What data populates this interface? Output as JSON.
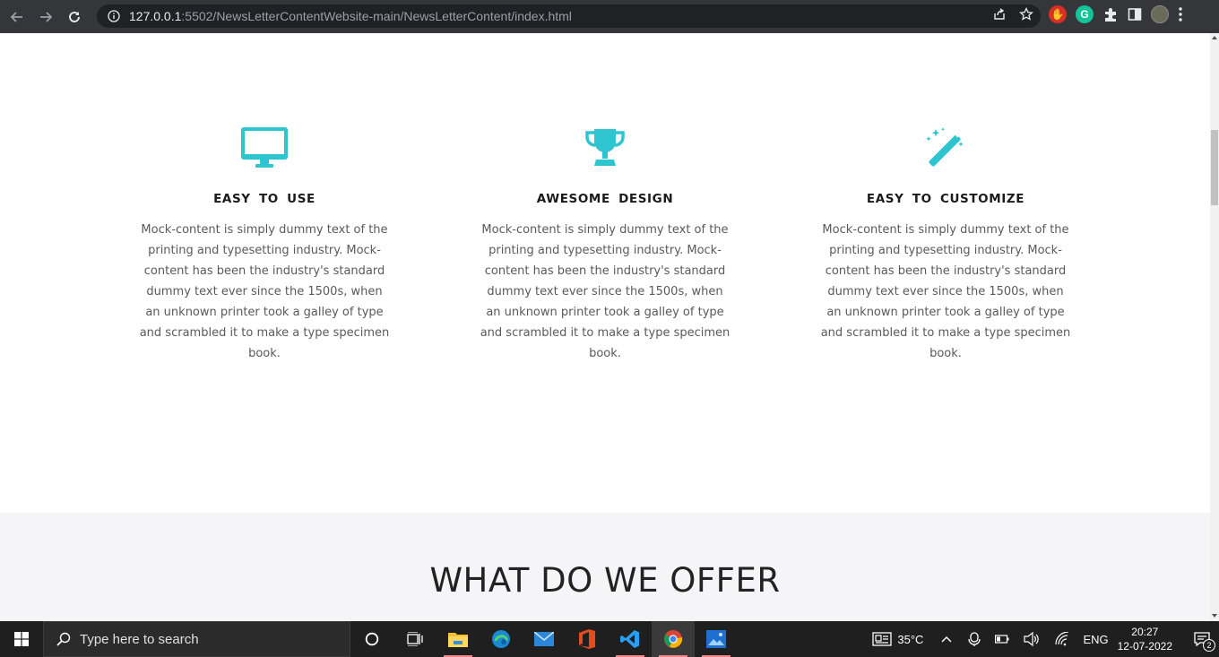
{
  "browser": {
    "url_host": "127.0.0.1",
    "url_path": ":5502/NewsLetterContentWebsite-main/NewsLetterContent/index.html"
  },
  "features": [
    {
      "icon": "monitor-icon",
      "title": "EASY TO USE",
      "text": "Mock-content is simply dummy text of the printing and typesetting industry. Mock-content has been the industry's standard dummy text ever since the 1500s, when an unknown printer took a galley of type and scrambled it to make a type specimen book."
    },
    {
      "icon": "trophy-icon",
      "title": "AWESOME DESIGN",
      "text": "Mock-content is simply dummy text of the printing and typesetting industry. Mock-content has been the industry's standard dummy text ever since the 1500s, when an unknown printer took a galley of type and scrambled it to make a type specimen book."
    },
    {
      "icon": "magic-wand-icon",
      "title": "EASY TO CUSTOMIZE",
      "text": "Mock-content is simply dummy text of the printing and typesetting industry. Mock-content has been the industry's standard dummy text ever since the 1500s, when an unknown printer took a galley of type and scrambled it to make a type specimen book."
    }
  ],
  "offer": {
    "heading": "WHAT DO WE OFFER"
  },
  "taskbar": {
    "search_placeholder": "Type here to search",
    "weather": "35°C",
    "language": "ENG",
    "time": "20:27",
    "date": "12-07-2022",
    "notifications": "2"
  },
  "colors": {
    "accent": "#2ec4d0",
    "chrome_bg": "#35363a",
    "taskbar_bg": "#1f1f1f"
  }
}
